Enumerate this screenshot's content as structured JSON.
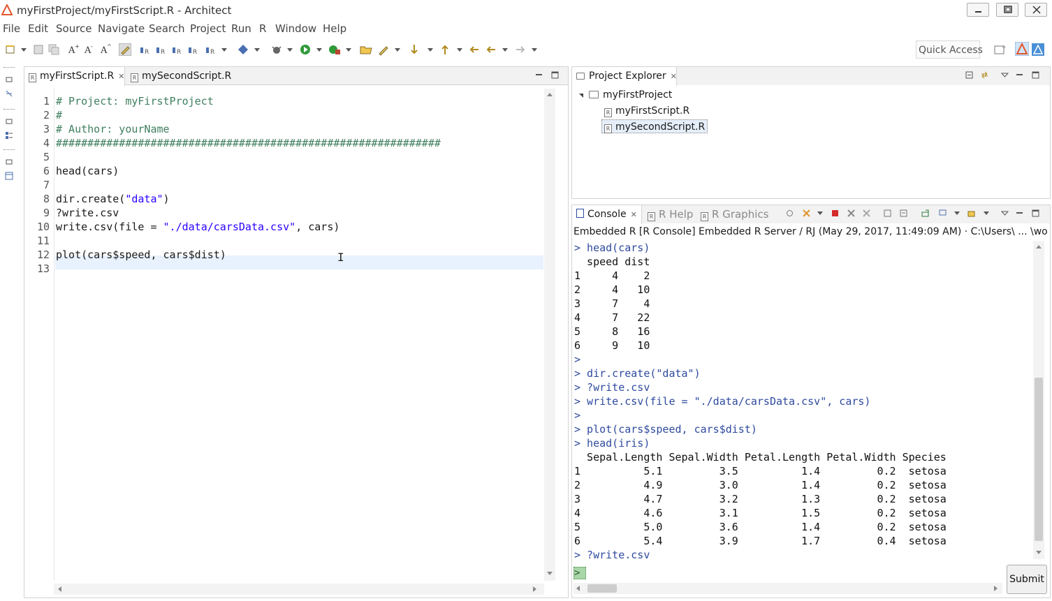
{
  "window": {
    "title": "myFirstProject/myFirstScript.R - Architect"
  },
  "menu": [
    "File",
    "Edit",
    "Source",
    "Navigate",
    "Search",
    "Project",
    "Run",
    "R",
    "Window",
    "Help"
  ],
  "toolbar": {
    "quick_access": "Quick Access"
  },
  "editor": {
    "tabs": [
      {
        "label": "myFirstScript.R",
        "active": true
      },
      {
        "label": "mySecondScript.R",
        "active": false
      }
    ],
    "line_numbers": [
      "1",
      "2",
      "3",
      "4",
      "5",
      "6",
      "7",
      "8",
      "9",
      "10",
      "11",
      "12",
      "13"
    ],
    "current_line": 13
  },
  "project_explorer": {
    "title": "Project Explorer",
    "project": "myFirstProject",
    "files": [
      "myFirstScript.R",
      "mySecondScript.R"
    ],
    "selected_file": "mySecondScript.R"
  },
  "console": {
    "tabs": {
      "console": "Console",
      "help": "R Help",
      "graphics": "R Graphics"
    },
    "header": "Embedded R [R Console] Embedded R Server / RJ (May 29, 2017, 11:49:09 AM)  ·  C:\\Users\\ ... \\workspac",
    "input_prompt": ">",
    "submit_label": "Submit"
  },
  "colors": {
    "comment": "#3f7f5f",
    "string": "#2a00ff",
    "console_echo": "#2e4a9e",
    "current_line": "#e8f2fe",
    "brand": "#e4572e"
  }
}
